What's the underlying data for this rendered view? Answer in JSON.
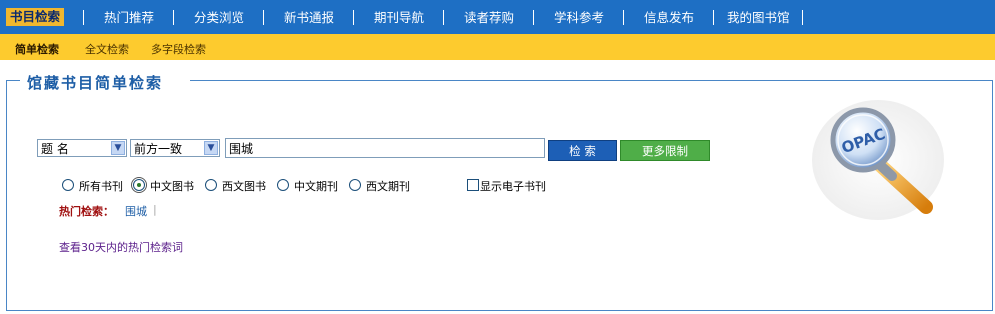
{
  "top_nav": {
    "items": [
      {
        "label": "书目检索",
        "active": true
      },
      {
        "label": "热门推荐"
      },
      {
        "label": "分类浏览"
      },
      {
        "label": "新书通报"
      },
      {
        "label": "期刊导航"
      },
      {
        "label": "读者荐购"
      },
      {
        "label": "学科参考"
      },
      {
        "label": "信息发布"
      },
      {
        "label": "我的图书馆"
      }
    ]
  },
  "sub_nav": {
    "items": [
      {
        "label": "简单检索",
        "active": true
      },
      {
        "label": "全文检索"
      },
      {
        "label": "多字段检索"
      }
    ]
  },
  "panel": {
    "title": "馆藏书目简单检索"
  },
  "search": {
    "field_select": "题 名",
    "match_select": "前方一致",
    "query_value": "围城",
    "search_button": "检 索",
    "more_button": "更多限制"
  },
  "doc_types": [
    {
      "label": "所有书刊",
      "checked": false
    },
    {
      "label": "中文图书",
      "checked": true
    },
    {
      "label": "西文图书",
      "checked": false
    },
    {
      "label": "中文期刊",
      "checked": false
    },
    {
      "label": "西文期刊",
      "checked": false
    }
  ],
  "show_ebooks": {
    "label": "显示电子书刊",
    "checked": false
  },
  "hot": {
    "label": "热门检索：",
    "terms": [
      "围城"
    ],
    "separator": "|",
    "link": "查看30天内的热门检索词"
  },
  "logo": {
    "text": "OPAC"
  },
  "colors": {
    "nav_bg": "#1e6fc4",
    "nav_active_bg": "#f0b72e",
    "subnav_bg": "#fdcb2e",
    "panel_border": "#4a86c6",
    "search_button": "#1d5fb6",
    "more_button": "#4fae48"
  }
}
